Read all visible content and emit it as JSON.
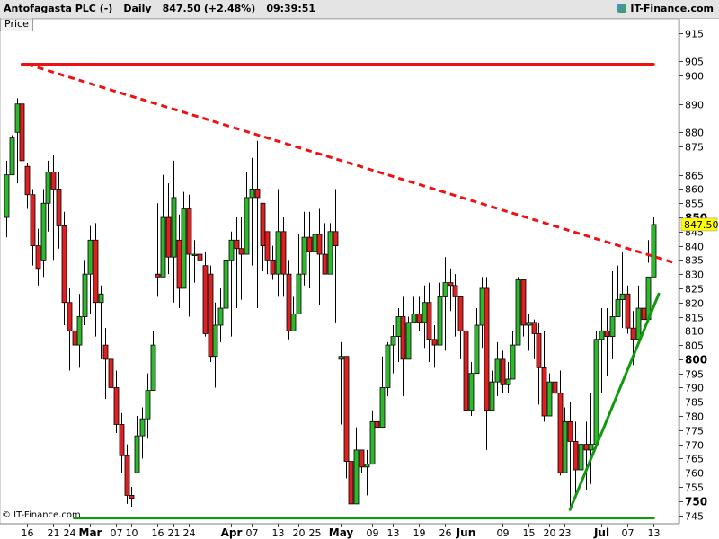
{
  "header": {
    "instrument": "Antofagasta PLC (-)",
    "period": "Daily",
    "last_change": "847.50 (+2.48%)",
    "time": "09:39:51",
    "site": "IT-Finance.com"
  },
  "price_tab": "Price",
  "footer": "© IT-Finance.com",
  "colors": {
    "up": "#2eb82e",
    "down": "#e02020",
    "resistance": "#ee1111",
    "support": "#119911",
    "last_label_bg": "#ffff00"
  },
  "chart_data": {
    "type": "candlestick",
    "ylim": [
      742,
      920
    ],
    "y_ticks": [
      745,
      750,
      755,
      760,
      765,
      770,
      775,
      780,
      785,
      790,
      795,
      800,
      805,
      810,
      815,
      820,
      825,
      830,
      835,
      840,
      845,
      850,
      855,
      860,
      865,
      875,
      880,
      890,
      900,
      905,
      915
    ],
    "y_major_ticks": [
      750,
      800,
      850
    ],
    "last_price_label": "847.50",
    "x_labels": [
      {
        "i": 4,
        "label": "16"
      },
      {
        "i": 9,
        "label": "21"
      },
      {
        "i": 12,
        "label": "24"
      },
      {
        "i": 16,
        "label": "Mar",
        "bold": true
      },
      {
        "i": 21,
        "label": "07"
      },
      {
        "i": 24,
        "label": "10"
      },
      {
        "i": 29,
        "label": "16"
      },
      {
        "i": 32,
        "label": "21"
      },
      {
        "i": 35,
        "label": "24"
      },
      {
        "i": 43,
        "label": "Apr",
        "bold": true
      },
      {
        "i": 47,
        "label": "07"
      },
      {
        "i": 52,
        "label": "13"
      },
      {
        "i": 56,
        "label": "20"
      },
      {
        "i": 59,
        "label": "25"
      },
      {
        "i": 64,
        "label": "May",
        "bold": true
      },
      {
        "i": 70,
        "label": "09"
      },
      {
        "i": 74,
        "label": "13"
      },
      {
        "i": 79,
        "label": "19"
      },
      {
        "i": 84,
        "label": "26"
      },
      {
        "i": 88,
        "label": "Jun",
        "bold": true
      },
      {
        "i": 95,
        "label": "09"
      },
      {
        "i": 100,
        "label": "15"
      },
      {
        "i": 104,
        "label": "20"
      },
      {
        "i": 107,
        "label": "23"
      },
      {
        "i": 114,
        "label": "Jul",
        "bold": true
      },
      {
        "i": 119,
        "label": "07"
      },
      {
        "i": 124,
        "label": "13"
      }
    ],
    "candles": [
      [
        850,
        865,
        843,
        870
      ],
      [
        865,
        878,
        870,
        879
      ],
      [
        880,
        890,
        862,
        892
      ],
      [
        890,
        870,
        860,
        895
      ],
      [
        868,
        858,
        853,
        869
      ],
      [
        858,
        840,
        833,
        860
      ],
      [
        840,
        832,
        826,
        846
      ],
      [
        835,
        855,
        829,
        860
      ],
      [
        855,
        866,
        845,
        870
      ],
      [
        866,
        860,
        835,
        872
      ],
      [
        860,
        847,
        839,
        866
      ],
      [
        847,
        820,
        812,
        852
      ],
      [
        820,
        810,
        796,
        825
      ],
      [
        810,
        805,
        790,
        813
      ],
      [
        805,
        815,
        797,
        823
      ],
      [
        815,
        830,
        812,
        835
      ],
      [
        830,
        842,
        816,
        847
      ],
      [
        842,
        820,
        808,
        848
      ],
      [
        820,
        823,
        800,
        826
      ],
      [
        805,
        800,
        786,
        811
      ],
      [
        800,
        790,
        780,
        815
      ],
      [
        790,
        777,
        774,
        796
      ],
      [
        777,
        766,
        760,
        781
      ],
      [
        766,
        752,
        749,
        770
      ],
      [
        752,
        751,
        748,
        755
      ],
      [
        760,
        773,
        767,
        780
      ],
      [
        773,
        779,
        765,
        783
      ],
      [
        779,
        789,
        772,
        795
      ],
      [
        789,
        805,
        792,
        810
      ],
      [
        830,
        829,
        822,
        855
      ],
      [
        829,
        850,
        845,
        865
      ],
      [
        850,
        836,
        830,
        862
      ],
      [
        836,
        857,
        820,
        870
      ],
      [
        842,
        825,
        818,
        851
      ],
      [
        825,
        853,
        836,
        859
      ],
      [
        853,
        837,
        815,
        858
      ],
      [
        837,
        837,
        827,
        842
      ],
      [
        837,
        835,
        827,
        838
      ],
      [
        833,
        809,
        808,
        838
      ],
      [
        830,
        801,
        799,
        833
      ],
      [
        801,
        812,
        790,
        820
      ],
      [
        812,
        818,
        806,
        825
      ],
      [
        818,
        835,
        830,
        845
      ],
      [
        835,
        842,
        808,
        845
      ],
      [
        842,
        839,
        818,
        850
      ],
      [
        839,
        837,
        821,
        850
      ],
      [
        837,
        857,
        850,
        866
      ],
      [
        857,
        860,
        833,
        871
      ],
      [
        860,
        857,
        818,
        877
      ],
      [
        855,
        840,
        831,
        854
      ],
      [
        845,
        835,
        830,
        840
      ],
      [
        835,
        830,
        828,
        840
      ],
      [
        830,
        845,
        822,
        860
      ],
      [
        845,
        830,
        822,
        850
      ],
      [
        830,
        810,
        807,
        835
      ],
      [
        810,
        816,
        812,
        822
      ],
      [
        816,
        830,
        822,
        844
      ],
      [
        830,
        843,
        826,
        852
      ],
      [
        843,
        838,
        825,
        852
      ],
      [
        838,
        844,
        816,
        848
      ],
      [
        844,
        837,
        819,
        853
      ],
      [
        837,
        830,
        832,
        848
      ],
      [
        830,
        845,
        836,
        848
      ],
      [
        845,
        840,
        813,
        860
      ],
      [
        800,
        801,
        777,
        806
      ],
      [
        801,
        764,
        758,
        778
      ],
      [
        764,
        749,
        745,
        770
      ],
      [
        749,
        768,
        762,
        776
      ],
      [
        768,
        762,
        760,
        768
      ],
      [
        762,
        763,
        752,
        768
      ],
      [
        763,
        778,
        764,
        782
      ],
      [
        778,
        776,
        770,
        786
      ],
      [
        776,
        790,
        778,
        801
      ],
      [
        790,
        805,
        787,
        806
      ],
      [
        805,
        808,
        795,
        812
      ],
      [
        808,
        815,
        799,
        818
      ],
      [
        815,
        800,
        787,
        822
      ],
      [
        800,
        813,
        806,
        815
      ],
      [
        813,
        816,
        815,
        822
      ],
      [
        816,
        813,
        810,
        822
      ],
      [
        813,
        820,
        804,
        826
      ],
      [
        820,
        807,
        799,
        827
      ],
      [
        807,
        805,
        797,
        812
      ],
      [
        805,
        822,
        813,
        827
      ],
      [
        822,
        827,
        803,
        836
      ],
      [
        827,
        826,
        817,
        832
      ],
      [
        826,
        822,
        808,
        830
      ],
      [
        822,
        810,
        800,
        814
      ],
      [
        810,
        782,
        766,
        820
      ],
      [
        782,
        795,
        780,
        799
      ],
      [
        795,
        812,
        800,
        818
      ],
      [
        812,
        825,
        804,
        829
      ],
      [
        825,
        782,
        768,
        829
      ],
      [
        782,
        792,
        785,
        796
      ],
      [
        792,
        800,
        787,
        806
      ],
      [
        800,
        791,
        788,
        803
      ],
      [
        791,
        793,
        788,
        799
      ],
      [
        793,
        805,
        796,
        810
      ],
      [
        805,
        828,
        808,
        829
      ],
      [
        828,
        812,
        808,
        828
      ],
      [
        812,
        813,
        803,
        816
      ],
      [
        813,
        809,
        800,
        814
      ],
      [
        809,
        797,
        784,
        813
      ],
      [
        797,
        780,
        778,
        810
      ],
      [
        780,
        792,
        781,
        795
      ],
      [
        792,
        788,
        760,
        794
      ],
      [
        788,
        760,
        759,
        796
      ],
      [
        760,
        778,
        764,
        783
      ],
      [
        778,
        771,
        748,
        785
      ],
      [
        771,
        761,
        751,
        778
      ],
      [
        761,
        770,
        754,
        782
      ],
      [
        770,
        768,
        754,
        778
      ],
      [
        768,
        770,
        756,
        788
      ],
      [
        770,
        807,
        795,
        810
      ],
      [
        807,
        810,
        788,
        818
      ],
      [
        810,
        808,
        794,
        818
      ],
      [
        808,
        815,
        800,
        831
      ],
      [
        815,
        821,
        815,
        833
      ],
      [
        821,
        823,
        811,
        838
      ],
      [
        823,
        811,
        809,
        826
      ],
      [
        811,
        807,
        798,
        817
      ],
      [
        807,
        818,
        814,
        826
      ],
      [
        818,
        814,
        812,
        836
      ],
      [
        814,
        829,
        834,
        842
      ],
      [
        829,
        847.5,
        838,
        850
      ]
    ],
    "trendlines": [
      {
        "name": "resistance-horizontal",
        "style": "solid",
        "color": "#ee1111",
        "from": [
          3,
          904
        ],
        "to": [
          124,
          904
        ]
      },
      {
        "name": "resistance-descending",
        "style": "dashed",
        "color": "#ee1111",
        "from": [
          4,
          904
        ],
        "to": [
          128,
          834
        ]
      },
      {
        "name": "support-horizontal",
        "style": "solid",
        "color": "#119911",
        "from": [
          13,
          744
        ],
        "to": [
          124,
          744
        ]
      },
      {
        "name": "support-rising",
        "style": "solid",
        "color": "#119911",
        "from": [
          108,
          747
        ],
        "to": [
          125,
          823
        ]
      }
    ]
  }
}
